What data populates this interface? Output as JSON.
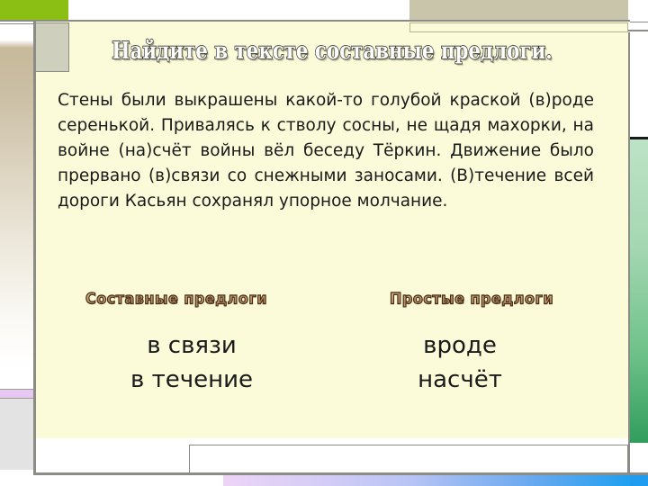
{
  "slide": {
    "title": "Найдите в тексте составные предлоги.",
    "body_text": "Стены были выкрашены какой-то голубой краской (в)роде серенькой. Привалясь к стволу сосны, не щадя махорки, на войне (на)счёт войны вёл беседу Тёркин. Движение было прервано (в)связи со снежными заносами. (В)течение всей дороги Касьян сохранял упорное молчание.",
    "columns": [
      {
        "heading": "Составные предлоги",
        "items": [
          "в связи",
          "в течение"
        ]
      },
      {
        "heading": "Простые предлоги",
        "items": [
          "вроде",
          "насчёт"
        ]
      }
    ]
  },
  "navigation": {
    "previous_icon": "left-arrow-icon",
    "back_icon": "back-slash-icon",
    "stop_icon": "stop-square-icon",
    "next_icon": "right-arrow-icon"
  },
  "colors": {
    "page_background": "#fbfbd9",
    "accent_green": "#8cbf13",
    "khaki": "#c8c5ab",
    "lilac": "#e7c8f2",
    "strip_green_light": "#bde3c6",
    "strip_green_dark": "#2f9c5b",
    "strip_blue": "#139ef0",
    "frame_grey": "#8c8c86",
    "text": "#1a1a1a",
    "wood_fill": "#c6a87e",
    "wood_outline": "#4a2c14"
  }
}
